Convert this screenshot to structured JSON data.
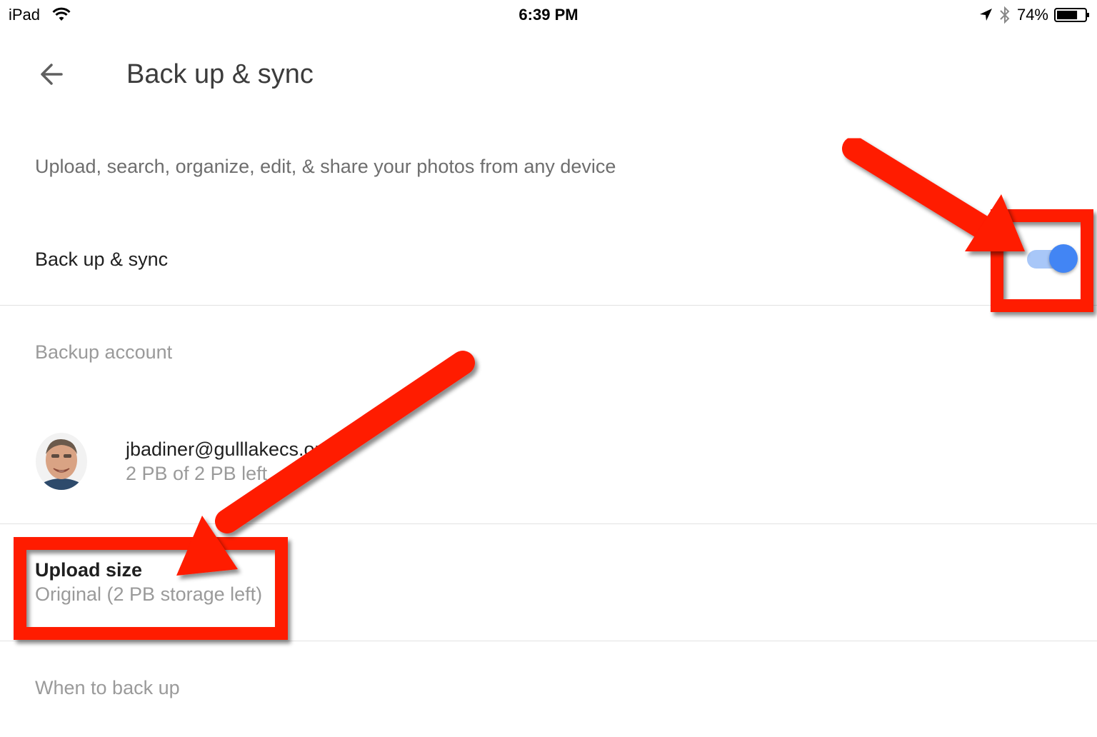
{
  "status_bar": {
    "device": "iPad",
    "time": "6:39 PM",
    "battery_percent": "74%",
    "battery_level": 0.74,
    "icons": [
      "wifi-icon",
      "location-arrow-icon",
      "bluetooth-icon",
      "battery-icon"
    ]
  },
  "header": {
    "back_icon": "arrow-left-icon",
    "title": "Back up & sync"
  },
  "description": "Upload, search, organize, edit, & share your photos from any device",
  "backup_sync": {
    "label": "Back up & sync",
    "enabled": true
  },
  "backup_account": {
    "section_label": "Backup account",
    "email": "jbadiner@gulllakecs.or",
    "storage": "2 PB of 2 PB left"
  },
  "upload_size": {
    "label": "Upload size",
    "value": "Original (2 PB storage left)"
  },
  "when_to_back_up": {
    "label": "When to back up"
  },
  "colors": {
    "toggle_accent": "#4285f4",
    "toggle_track": "#a8c7f8",
    "annotation_red": "#ff1a00"
  }
}
